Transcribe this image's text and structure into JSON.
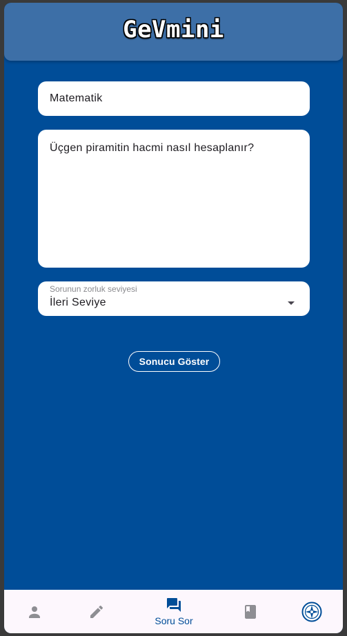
{
  "app": {
    "title": "GeVmini"
  },
  "form": {
    "subject_value": "Matematik",
    "question_value": "Üçgen piramitin hacmi nasıl hesaplanır?",
    "difficulty": {
      "label": "Sorunun zorluk seviyesi",
      "selected": "İleri Seviye"
    },
    "submit_label": "Sonucu Göster"
  },
  "bottom_nav": {
    "items": [
      {
        "icon": "person-icon",
        "label": "",
        "active": false
      },
      {
        "icon": "pencil-icon",
        "label": "",
        "active": false
      },
      {
        "icon": "chat-bubbles-icon",
        "label": "Soru Sor",
        "active": true
      },
      {
        "icon": "book-icon",
        "label": "",
        "active": false
      },
      {
        "icon": "gemini-logo-icon",
        "label": "",
        "active": false
      }
    ]
  },
  "colors": {
    "background": "#004d98",
    "appbar": "#3d6fa7",
    "nav_background": "#fdf7fd",
    "nav_active": "#004d98",
    "nav_inactive": "#8e8e93"
  }
}
